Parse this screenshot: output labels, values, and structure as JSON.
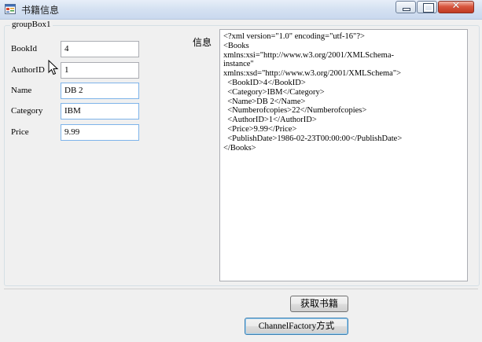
{
  "window": {
    "title": "书籍信息"
  },
  "groupbox": {
    "label": "groupBox1"
  },
  "fields": [
    {
      "label": "BookId",
      "value": "4"
    },
    {
      "label": "AuthorID",
      "value": "1"
    },
    {
      "label": "Name",
      "value": "DB 2"
    },
    {
      "label": "Category",
      "value": "IBM"
    },
    {
      "label": "Price",
      "value": "9.99"
    }
  ],
  "info": {
    "label": "信息",
    "text": "<?xml version=\"1.0\" encoding=\"utf-16\"?>\n<Books\nxmlns:xsi=\"http://www.w3.org/2001/XMLSchema-\ninstance\"\nxmlns:xsd=\"http://www.w3.org/2001/XMLSchema\">\n  <BookID>4</BookID>\n  <Category>IBM</Category>\n  <Name>DB 2</Name>\n  <Numberofcopies>22</Numberofcopies>\n  <AuthorID>1</AuthorID>\n  <Price>9.99</Price>\n  <PublishDate>1986-02-23T00:00:00</PublishDate>\n</Books>"
  },
  "buttons": {
    "fetch": "获取书籍",
    "channel_factory": "ChannelFactory方式"
  },
  "icons": {
    "app": "form-icon",
    "minimize": "minimize-icon",
    "maximize": "maximize-icon",
    "close": "close-icon",
    "cursor": "mouse-pointer-icon"
  }
}
